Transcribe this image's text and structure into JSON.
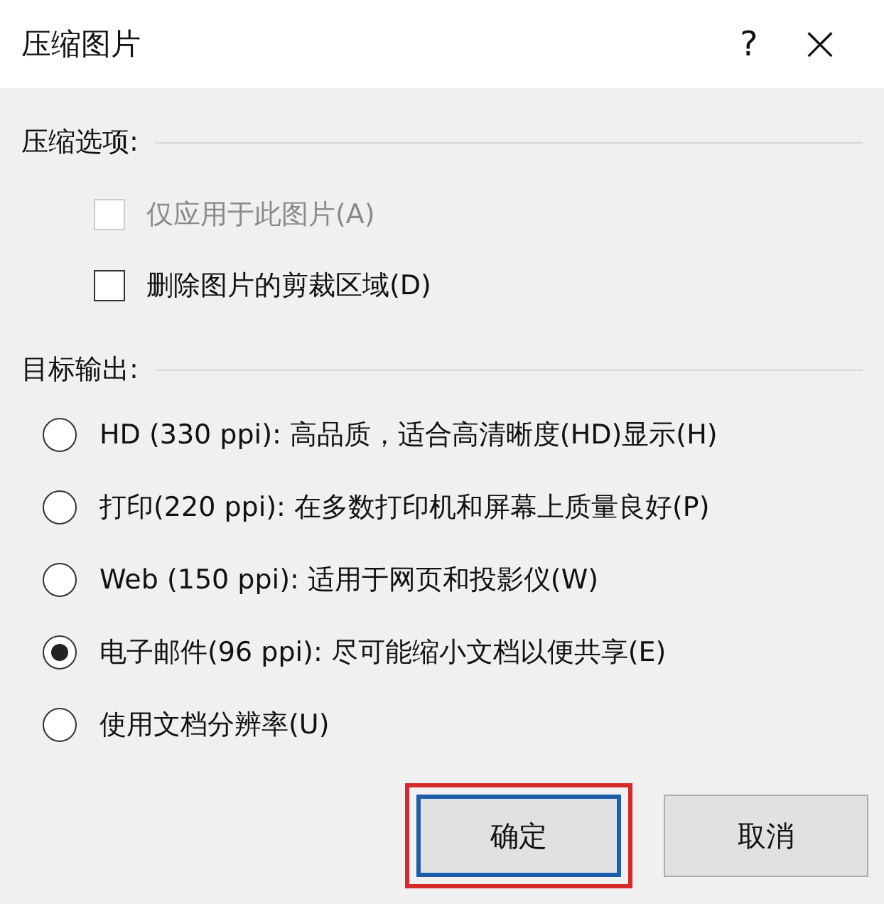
{
  "window": {
    "title": "压缩图片",
    "help": "?",
    "close": "×"
  },
  "compression_options": {
    "label": "压缩选项:",
    "checkboxes": [
      {
        "label": "仅应用于此图片(A)",
        "checked": false,
        "disabled": true
      },
      {
        "label": "删除图片的剪裁区域(D)",
        "checked": false,
        "disabled": false
      }
    ]
  },
  "target_output": {
    "label": "目标输出:",
    "options": [
      {
        "label": "HD (330 ppi): 高品质，适合高清晰度(HD)显示(H)",
        "selected": false
      },
      {
        "label": "打印(220 ppi): 在多数打印机和屏幕上质量良好(P)",
        "selected": false
      },
      {
        "label": "Web (150 ppi): 适用于网页和投影仪(W)",
        "selected": false
      },
      {
        "label": "电子邮件(96 ppi): 尽可能缩小文档以便共享(E)",
        "selected": true
      },
      {
        "label": "使用文档分辨率(U)",
        "selected": false
      }
    ]
  },
  "buttons": [
    {
      "label": "确定",
      "default": true,
      "highlighted": true
    },
    {
      "label": "取消",
      "default": false,
      "highlighted": false
    }
  ]
}
